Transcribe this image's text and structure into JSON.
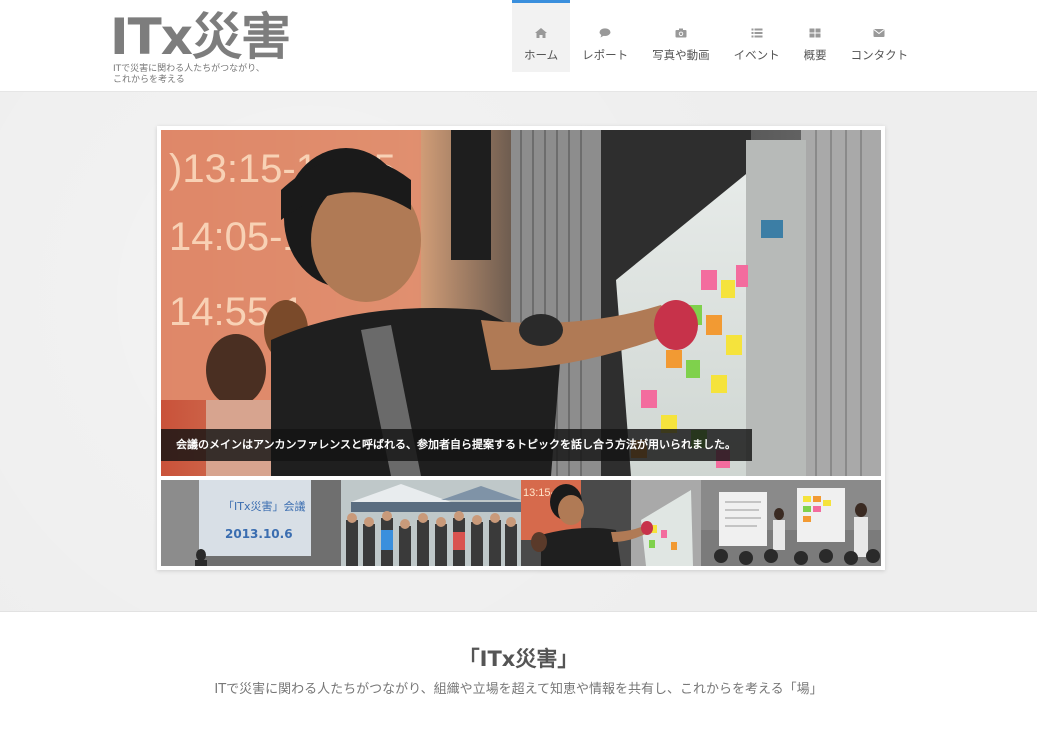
{
  "site": {
    "logo_text": "ITx災害",
    "tagline_line1": "ITで災害に関わる人たちがつながり、",
    "tagline_line2": "これからを考える"
  },
  "nav": {
    "items": [
      {
        "label": "ホーム",
        "icon": "home-icon",
        "active": true
      },
      {
        "label": "レポート",
        "icon": "comment-icon",
        "active": false
      },
      {
        "label": "写真や動画",
        "icon": "camera-icon",
        "active": false
      },
      {
        "label": "イベント",
        "icon": "list-icon",
        "active": false
      },
      {
        "label": "概要",
        "icon": "grid-icon",
        "active": false
      },
      {
        "label": "コンタクト",
        "icon": "envelope-icon",
        "active": false
      }
    ],
    "accent_color": "#3a8fdd"
  },
  "slider": {
    "caption": "会議のメインはアンカンファレンスと呼ばれる、参加者自ら提案するトピックを話し合う方法が用いられました。",
    "main_image_text": {
      "clock1": ")13:15-13:55",
      "clock2": "14:05-1",
      "clock3": "14:55-1"
    },
    "thumb1_title": "「ITx災害」会議",
    "thumb1_date": "2013.10.6",
    "thumb3_clock": "13:15-1"
  },
  "intro": {
    "title": "「ITx災害」",
    "description": "ITで災害に関わる人たちがつながり、組織や立場を超えて知恵や情報を共有し、これからを考える「場」"
  }
}
